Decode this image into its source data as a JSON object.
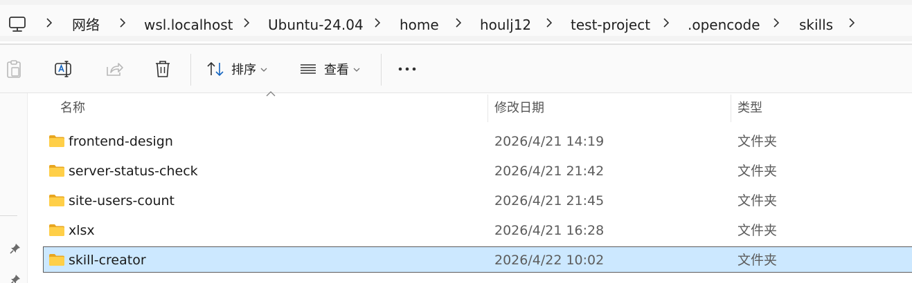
{
  "address": {
    "crumbs": [
      "网络",
      "wsl.localhost",
      "Ubuntu-24.04",
      "home",
      "houlj12",
      "test-project",
      ".opencode",
      "skills"
    ]
  },
  "toolbar": {
    "sort_label": "排序",
    "view_label": "查看"
  },
  "columns": {
    "name": "名称",
    "modified": "修改日期",
    "type": "类型"
  },
  "files": [
    {
      "name": "frontend-design",
      "modified": "2026/4/21 14:19",
      "type": "文件夹",
      "selected": false
    },
    {
      "name": "server-status-check",
      "modified": "2026/4/21 21:42",
      "type": "文件夹",
      "selected": false
    },
    {
      "name": "site-users-count",
      "modified": "2026/4/21 21:45",
      "type": "文件夹",
      "selected": false
    },
    {
      "name": "xlsx",
      "modified": "2026/4/21 16:28",
      "type": "文件夹",
      "selected": false
    },
    {
      "name": "skill-creator",
      "modified": "2026/4/22 10:02",
      "type": "文件夹",
      "selected": true
    }
  ],
  "colors": {
    "selection_bg": "#cce8ff",
    "folder_yellow": "#ffc83d"
  }
}
